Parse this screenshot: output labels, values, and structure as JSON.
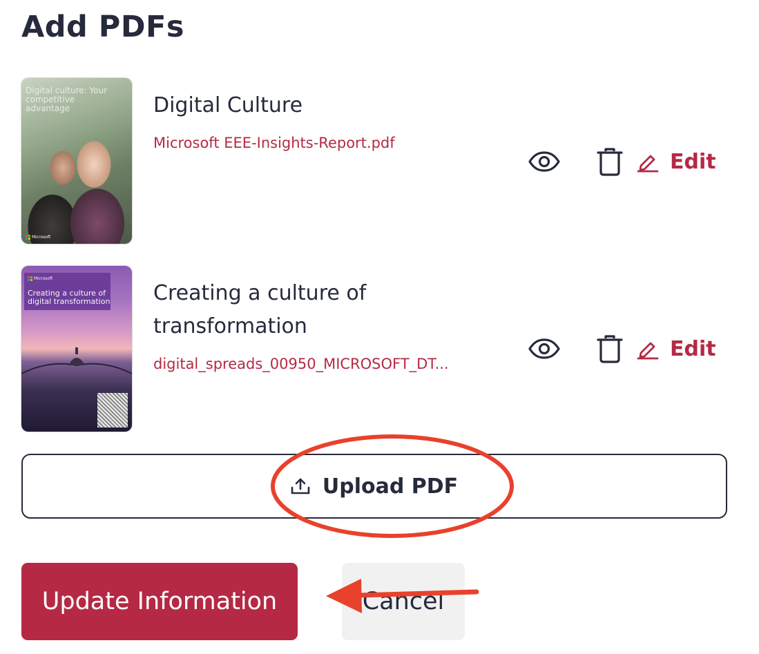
{
  "page": {
    "title": "Add PDFs"
  },
  "pdfs": [
    {
      "title": "Digital Culture",
      "filename": "Microsoft EEE-Insights-Report.pdf",
      "thumbnail_text": "Digital culture: Your competitive advantage",
      "thumbnail_brand": "Microsoft"
    },
    {
      "title": "Creating a culture of transformation",
      "filename": "digital_spreads_00950_MICROSOFT_DT...",
      "thumbnail_text": "Creating a culture of digital transformation",
      "thumbnail_brand": "Microsoft"
    }
  ],
  "actions": {
    "edit_label": "Edit",
    "view_icon": "eye-icon",
    "delete_icon": "trash-icon",
    "edit_icon": "pencil-icon"
  },
  "upload": {
    "label": "Upload PDF",
    "icon": "upload-icon"
  },
  "footer": {
    "update_label": "Update Information",
    "cancel_label": "Cancel"
  },
  "colors": {
    "accent": "#b52944",
    "text": "#262a3b",
    "annotation": "#e8412c"
  }
}
